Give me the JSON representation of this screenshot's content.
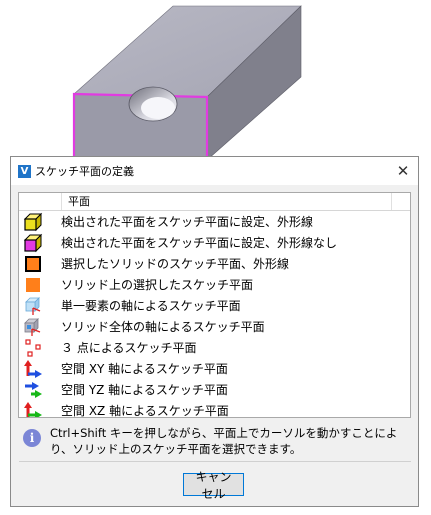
{
  "dialog": {
    "title": "スケッチ平面の定義",
    "close_glyph": "✕",
    "column_header": "平面",
    "items": [
      {
        "label": "検出された平面をスケッチ平面に設定、外形線",
        "icon": "yellow-cube-icon"
      },
      {
        "label": "検出された平面をスケッチ平面に設定、外形線なし",
        "icon": "magenta-cube-icon"
      },
      {
        "label": "選択したソリッドのスケッチ平面、外形線",
        "icon": "orange-square-outline-icon"
      },
      {
        "label": "ソリッド上の選択したスケッチ平面",
        "icon": "orange-square-icon"
      },
      {
        "label": "単一要素の軸によるスケッチ平面",
        "icon": "single-element-axis-icon"
      },
      {
        "label": "ソリッド全体の軸によるスケッチ平面",
        "icon": "whole-solid-axis-icon"
      },
      {
        "label": "３ 点によるスケッチ平面",
        "icon": "three-points-icon"
      },
      {
        "label": "空間 XY 軸によるスケッチ平面",
        "icon": "xy-axis-arrows-icon"
      },
      {
        "label": "空間 YZ 軸によるスケッチ平面",
        "icon": "yz-axis-arrows-icon"
      },
      {
        "label": "空間 XZ 軸によるスケッチ平面",
        "icon": "xz-axis-arrows-icon"
      }
    ],
    "info_text": "Ctrl+Shift キーを押しながら、平面上でカーソルを動かすことにより、ソリッド上のスケッチ平面を選択できます。",
    "cancel_label": "キャンセル"
  }
}
